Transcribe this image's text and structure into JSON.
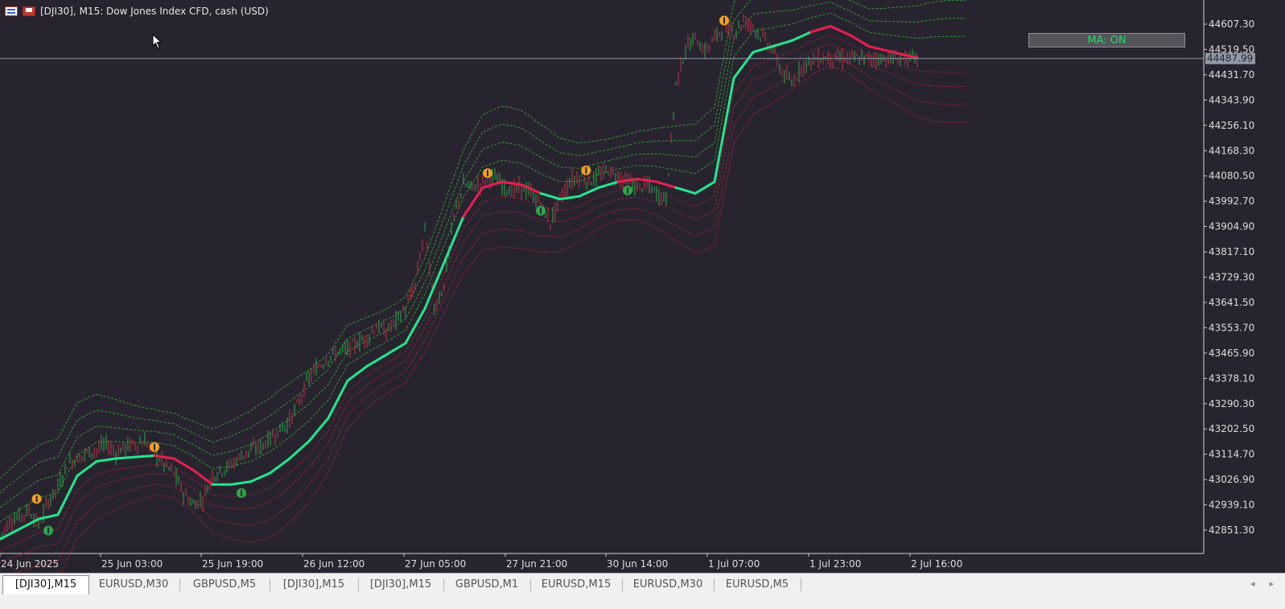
{
  "window": {
    "title": "[DJI30], M15:  Dow Jones Index CFD, cash (USD)",
    "ma_button_label": "MA: ON"
  },
  "tabs": [
    {
      "label": "[DJI30],M15",
      "active": true
    },
    {
      "label": "EURUSD,M30",
      "active": false
    },
    {
      "label": "GBPUSD,M5",
      "active": false
    },
    {
      "label": "[DJI30],M15",
      "active": false
    },
    {
      "label": "[DJI30],M15",
      "active": false
    },
    {
      "label": "GBPUSD,M1",
      "active": false
    },
    {
      "label": "EURUSD,M15",
      "active": false
    },
    {
      "label": "EURUSD,M30",
      "active": false
    },
    {
      "label": "EURUSD,M5",
      "active": false
    }
  ],
  "tab_scroll": {
    "left": "◂",
    "right": "▸"
  },
  "colors": {
    "background": "#28242f",
    "grid_text": "#dcdcdc",
    "ma_up": "#22e88c",
    "ma_down": "#e8204e",
    "band_upper": "#33cc33",
    "band_lower": "#c4203a",
    "candle_bull": "#2aa84a",
    "candle_bear": "#c43248",
    "signal_up": "#2aa84a",
    "signal_down": "#f0a020",
    "price_line": "#8e9aa6"
  },
  "chart_data": {
    "type": "line",
    "symbol": "[DJI30]",
    "timeframe": "M15",
    "y_axis": {
      "ticks": [
        "44607.30",
        "44519.50",
        "44431.70",
        "44343.90",
        "44256.10",
        "44168.30",
        "44080.50",
        "43992.70",
        "43904.90",
        "43817.10",
        "43729.30",
        "43641.50",
        "43553.70",
        "43465.90",
        "43378.10",
        "43290.30",
        "43202.50",
        "43114.70",
        "43026.90",
        "42939.10",
        "42851.30"
      ],
      "ylim": [
        42800,
        44640
      ]
    },
    "x_axis": {
      "ticks": [
        "24 Jun 2025",
        "25 Jun 03:00",
        "25 Jun 19:00",
        "26 Jun 12:00",
        "27 Jun 05:00",
        "27 Jun 21:00",
        "30 Jun 14:00",
        "1 Jul 07:00",
        "1 Jul 23:00",
        "2 Jul 16:00"
      ],
      "xlim": [
        0,
        1000
      ]
    },
    "current_price": "44487.99",
    "price_series": {
      "x": [
        0,
        10,
        20,
        30,
        40,
        50,
        60,
        70,
        80,
        90,
        100,
        110,
        120,
        130,
        140,
        150,
        160,
        170,
        180,
        190,
        200,
        210,
        220,
        230,
        240,
        250,
        260,
        270,
        280,
        290,
        300,
        310,
        320,
        330,
        340,
        350,
        360,
        370,
        380,
        390,
        400,
        410,
        420,
        430,
        440,
        450,
        460,
        470,
        480,
        490,
        500,
        510,
        520,
        530,
        540,
        550,
        560,
        570,
        580,
        590,
        600,
        610,
        620,
        630,
        640,
        650,
        660,
        670,
        680,
        690,
        700,
        710,
        720,
        730,
        740,
        750,
        760,
        770,
        780,
        790,
        800,
        810,
        820,
        830,
        840,
        850,
        860,
        870,
        880,
        890,
        900,
        910,
        920,
        930,
        940,
        950
      ],
      "y": [
        42830,
        42880,
        42900,
        42920,
        42870,
        42950,
        43000,
        43080,
        43100,
        43120,
        43130,
        43150,
        43120,
        43140,
        43150,
        43160,
        43120,
        43080,
        43050,
        42980,
        42940,
        42960,
        43040,
        43060,
        43080,
        43110,
        43130,
        43140,
        43170,
        43200,
        43230,
        43300,
        43380,
        43420,
        43450,
        43470,
        43480,
        43500,
        43520,
        43560,
        43540,
        43580,
        43620,
        43700,
        43900,
        43620,
        43700,
        43940,
        44050,
        44040,
        44060,
        44080,
        44050,
        44030,
        44040,
        44020,
        43980,
        43920,
        44000,
        44060,
        44080,
        44060,
        44080,
        44100,
        44080,
        44060,
        44040,
        44050,
        44020,
        44000,
        44400,
        44520,
        44560,
        44510,
        44560,
        44600,
        44580,
        44620,
        44600,
        44560,
        44520,
        44440,
        44400,
        44460,
        44480,
        44490,
        44488,
        44488,
        44488,
        44488,
        44488,
        44488,
        44488,
        44488,
        44488,
        44488
      ]
    },
    "series": [
      {
        "name": "MA",
        "x": [
          0,
          40,
          60,
          80,
          100,
          120,
          140,
          160,
          180,
          200,
          220,
          240,
          260,
          280,
          300,
          320,
          340,
          360,
          380,
          400,
          420,
          440,
          460,
          480,
          500,
          520,
          540,
          560,
          580,
          600,
          620,
          640,
          660,
          680,
          700,
          720,
          740,
          760,
          780,
          800,
          820,
          840,
          860,
          880,
          900,
          950
        ],
        "y": [
          42820,
          42890,
          42905,
          43040,
          43090,
          43100,
          43105,
          43110,
          43100,
          43060,
          43010,
          43010,
          43020,
          43050,
          43100,
          43160,
          43240,
          43370,
          43420,
          43460,
          43500,
          43620,
          43780,
          43940,
          44040,
          44060,
          44050,
          44020,
          44000,
          44010,
          44040,
          44060,
          44070,
          44060,
          44040,
          44020,
          44060,
          44420,
          44510,
          44530,
          44550,
          44580,
          44600,
          44570,
          44530,
          44490
        ],
        "trend": [
          "up",
          "up",
          "up",
          "up",
          "up",
          "up",
          "up",
          "up",
          "down",
          "down",
          "down",
          "up",
          "up",
          "up",
          "up",
          "up",
          "up",
          "up",
          "up",
          "up",
          "up",
          "up",
          "up",
          "up",
          "down",
          "down",
          "down",
          "down",
          "up",
          "up",
          "up",
          "up",
          "down",
          "down",
          "down",
          "up",
          "up",
          "up",
          "up",
          "up",
          "up",
          "up",
          "down",
          "down",
          "down",
          "down"
        ]
      }
    ],
    "signals": [
      {
        "x": 38,
        "y": 42960,
        "type": "sell"
      },
      {
        "x": 50,
        "y": 42850,
        "type": "buy"
      },
      {
        "x": 160,
        "y": 43140,
        "type": "sell"
      },
      {
        "x": 250,
        "y": 42980,
        "type": "buy"
      },
      {
        "x": 505,
        "y": 44090,
        "type": "sell"
      },
      {
        "x": 560,
        "y": 43960,
        "type": "buy"
      },
      {
        "x": 607,
        "y": 44100,
        "type": "sell"
      },
      {
        "x": 650,
        "y": 44030,
        "type": "buy"
      },
      {
        "x": 750,
        "y": 44620,
        "type": "sell"
      }
    ],
    "bands": {
      "upper_offsets": [
        60,
        110,
        160,
        210
      ],
      "lower_offsets": [
        40,
        80,
        130,
        180
      ]
    },
    "grid": false
  }
}
